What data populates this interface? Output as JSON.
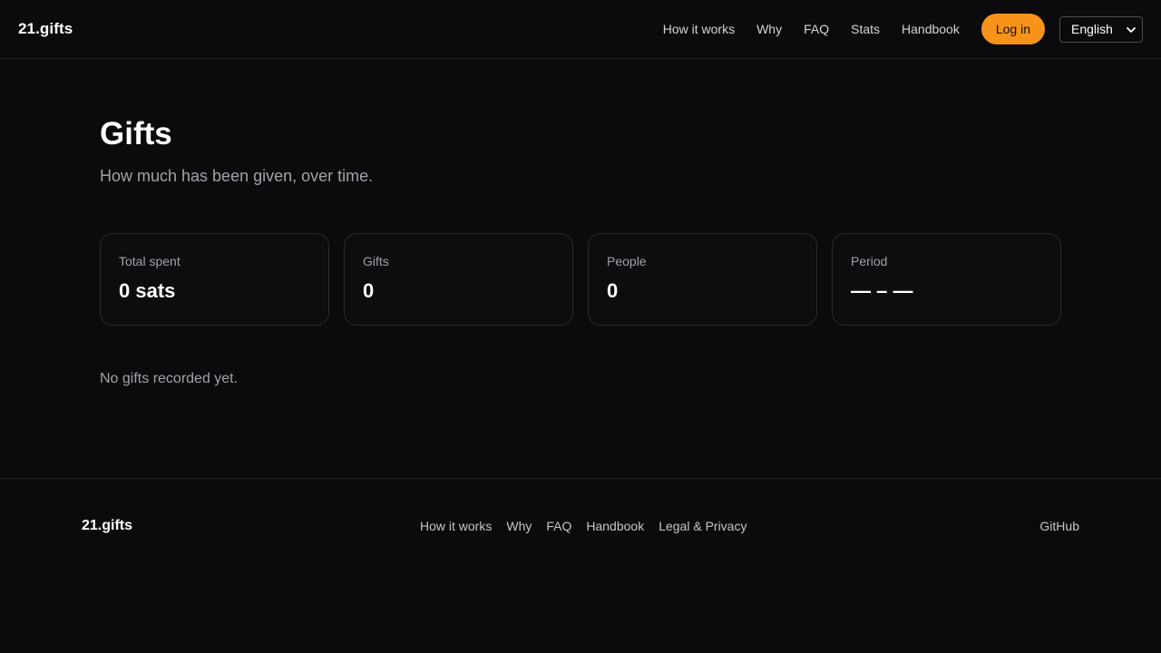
{
  "header": {
    "brand": "21.gifts",
    "nav": [
      {
        "label": "How it works"
      },
      {
        "label": "Why"
      },
      {
        "label": "FAQ"
      },
      {
        "label": "Stats"
      },
      {
        "label": "Handbook"
      }
    ],
    "login_label": "Log in",
    "language": "English"
  },
  "main": {
    "title": "Gifts",
    "subtitle": "How much has been given, over time.",
    "cards": [
      {
        "label": "Total spent",
        "value": "0 sats"
      },
      {
        "label": "Gifts",
        "value": "0"
      },
      {
        "label": "People",
        "value": "0"
      },
      {
        "label": "Period",
        "value": "— – —"
      }
    ],
    "empty_message": "No gifts recorded yet."
  },
  "footer": {
    "brand": "21.gifts",
    "links": [
      {
        "label": "How it works"
      },
      {
        "label": "Why"
      },
      {
        "label": "FAQ"
      },
      {
        "label": "Handbook"
      },
      {
        "label": "Legal & Privacy"
      }
    ],
    "github": "GitHub"
  },
  "colors": {
    "background": "#0b0b0d",
    "accent": "#f7931a",
    "muted_text": "#a1a1aa",
    "border": "#2a2a30"
  },
  "icons": {
    "language_dropdown": "chevron-down-icon"
  }
}
